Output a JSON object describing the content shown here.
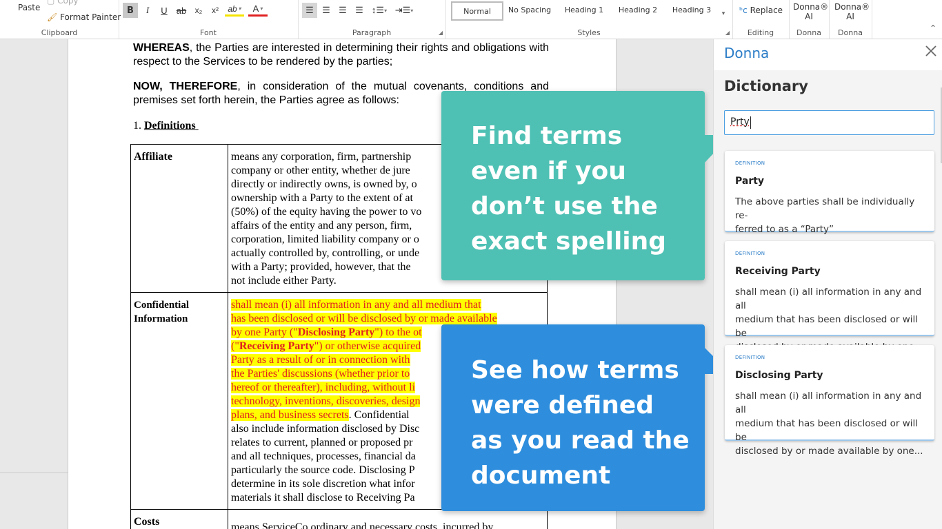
{
  "ribbon": {
    "clipboard": {
      "paste": "Paste",
      "copy": "Copy",
      "format_painter": "Format Painter",
      "label": "Clipboard"
    },
    "font": {
      "label": "Font",
      "bold": "B",
      "italic": "I",
      "underline": "U",
      "strike": "ab",
      "subscript": "x₂",
      "superscript": "x²",
      "highlight": "ab",
      "font_color": "A"
    },
    "paragraph": {
      "label": "Paragraph"
    },
    "styles": {
      "label": "Styles",
      "items": [
        "Normal",
        "No Spacing",
        "Heading 1",
        "Heading 2",
        "Heading 3"
      ]
    },
    "editing": {
      "label": "Editing",
      "replace": "Replace"
    },
    "donna1": {
      "button": "Donna®",
      "sub": "AI",
      "label": "Donna"
    },
    "donna2": {
      "button": "Donna®",
      "sub": "AI",
      "label": "Donna"
    }
  },
  "document": {
    "whereas_bold": "WHEREAS",
    "whereas_text": ", the Parties are interested in determining their rights and obligations with respect to the Services to be rendered by the parties;",
    "now_bold": "NOW, THEREFORE",
    "now_text": ", in consideration of the mutual covenants, conditions and premises set forth herein, the Parties agree as follows:",
    "section_num": "1.",
    "section_title": "Definitions",
    "rows": [
      {
        "term": "Affiliate",
        "lines": [
          "means any corporation, firm, partnership",
          "company or other entity, whether de jure",
          "directly or indirectly owns, is owned by, o",
          "ownership with a Party to the extent of at",
          "(50%) of the equity having the power to vo",
          "affairs of the entity and any person, firm,",
          "corporation, limited liability company or o",
          "actually controlled by, controlling, or unde",
          "with a Party; provided, however, that the",
          "not include either Party."
        ]
      },
      {
        "term": "Confidential Information",
        "hl_lines_a": [
          "shall mean (i) all information in any and all medium that",
          "has been disclosed or will be disclosed by or made available",
          "by one Party (\""
        ],
        "disclosing_party": "Disclosing Party",
        "hl_mid_a": "\") to the ot",
        "hl_open": "(\"",
        "receiving_party": "Receiving Party",
        "hl_mid_b": "\") or otherwise acquired",
        "hl_lines_b": [
          "Party as a result of or in connection with",
          "the Parties' discussions (whether prior to",
          "hereof or thereafter), including, without li",
          "technology, inventions, discoveries, design"
        ],
        "hl_last": "plans, and business secrets",
        "plain_tail": ". Confidential",
        "plain_lines": [
          "also include information disclosed by Disc",
          "relates to current, planned or proposed pr",
          "and all techniques, processes, financial da",
          "particularly the source code. Disclosing P",
          "determine in its sole discretion what infor",
          "materials it shall disclose to Receiving Pa"
        ]
      },
      {
        "term": "Costs",
        "line_pre": "means ",
        "line_squig": "ServiceCo",
        "line_post": " ordinary and necessary costs, incurred by"
      }
    ]
  },
  "callouts": {
    "green": [
      "Find terms",
      "even if you",
      "don’t use the",
      "exact spelling"
    ],
    "blue": [
      "See how terms",
      "were defined",
      "as you read the",
      "document"
    ]
  },
  "panel": {
    "title": "Donna",
    "section": "Dictionary",
    "search_value": "Prty",
    "results": [
      {
        "tag": "DEFINITION",
        "title": "Party",
        "body": [
          "The above parties shall be individually re-",
          "ferred to as a “Party”"
        ]
      },
      {
        "tag": "DEFINITION",
        "title": "Receiving Party",
        "body": [
          "shall mean (i) all information in any and all",
          "medium that has been disclosed or will be",
          "disclosed by or made available by one..."
        ]
      },
      {
        "tag": "DEFINITION",
        "title": "Disclosing Party",
        "body": [
          "shall mean (i) all information in any and all",
          "medium that has been disclosed or will be",
          "disclosed by or made available by one..."
        ]
      }
    ]
  },
  "colors": {
    "green": "#4fc1b4",
    "blue": "#2e8edd",
    "accent": "#2a7cc7",
    "highlight": "#ffff00",
    "highlight_text": "#e02020"
  }
}
